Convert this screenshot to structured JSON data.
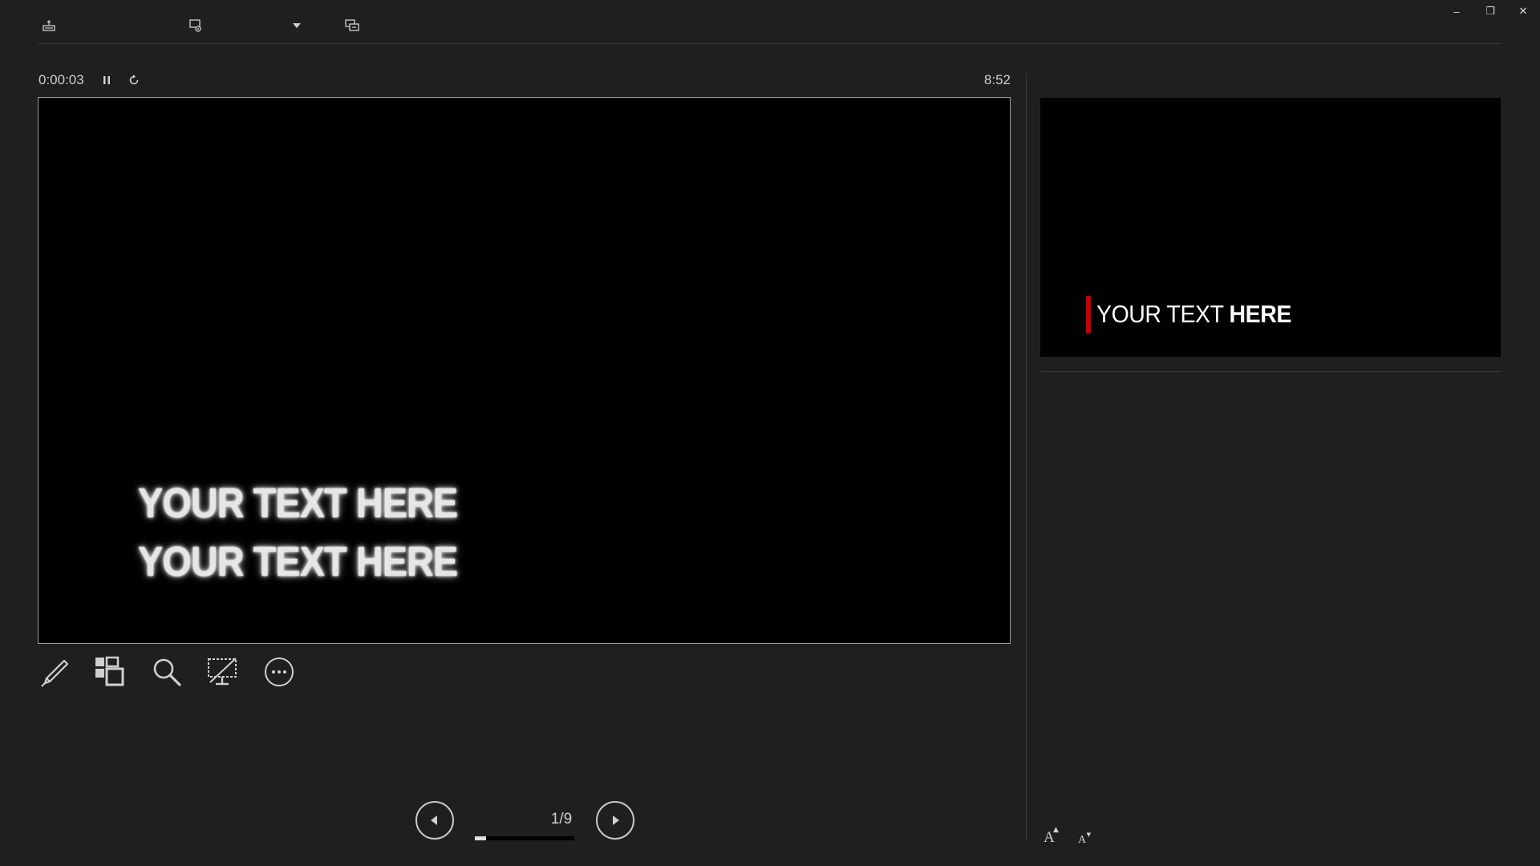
{
  "toolbar": {
    "items": [
      {
        "icon": "taskbar-icon"
      },
      {
        "icon": "display-settings-icon"
      },
      {
        "icon": "dropdown-arrow-icon"
      },
      {
        "icon": "swap-displays-icon"
      }
    ]
  },
  "window_controls": {
    "minimize": "–",
    "restore": "❐",
    "close": "✕"
  },
  "presenter": {
    "elapsed_time": "0:00:03",
    "clock": "8:52"
  },
  "current_slide": {
    "lines": [
      "YOUR TEXT HERE",
      "YOUR TEXT HERE"
    ]
  },
  "tools": [
    {
      "icon": "pen-icon"
    },
    {
      "icon": "see-all-slides-icon"
    },
    {
      "icon": "zoom-icon"
    },
    {
      "icon": "black-screen-icon"
    },
    {
      "icon": "more-options-icon"
    }
  ],
  "navigation": {
    "counter": "1/9",
    "progress": 0.11
  },
  "next_slide": {
    "text_regular": "YOUR TEXT ",
    "text_bold": "HERE",
    "accent_color": "#c40000"
  },
  "notes": {
    "increase_font_label": "A",
    "decrease_font_label": "A"
  }
}
